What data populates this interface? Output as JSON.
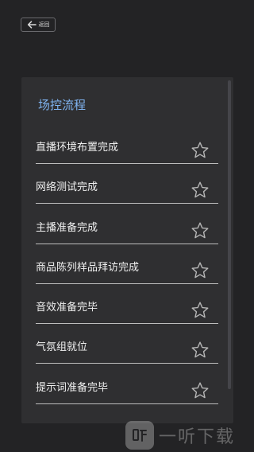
{
  "header": {
    "back_label": "返回"
  },
  "card": {
    "title": "场控流程",
    "items": [
      {
        "label": "直播环境布置完成"
      },
      {
        "label": "网络测试完成"
      },
      {
        "label": "主播准备完成"
      },
      {
        "label": "商品陈列样品拜访完成"
      },
      {
        "label": "音效准备完毕"
      },
      {
        "label": "气氛组就位"
      },
      {
        "label": "提示词准备完毕"
      }
    ]
  },
  "watermark": {
    "text": "一听下载"
  },
  "colors": {
    "background": "#232325",
    "card": "#2f2f31",
    "accent": "#7fb3f0",
    "text": "#f0f0f0",
    "divider": "#bdbdbd",
    "star_outline": "#b5b5b5"
  },
  "icons": {
    "back": "arrow-left-icon",
    "item": "star-outline-icon"
  }
}
